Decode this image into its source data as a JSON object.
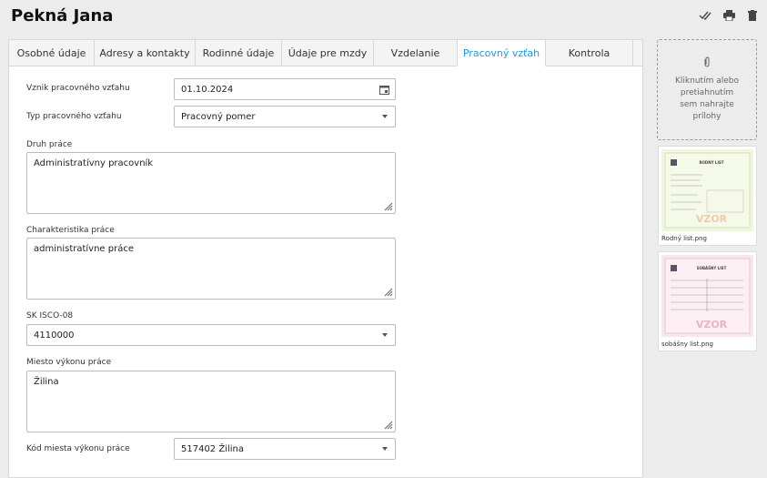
{
  "header": {
    "title": "Pekná Jana"
  },
  "tabs": [
    {
      "label": "Osobné údaje"
    },
    {
      "label": "Adresy a kontakty"
    },
    {
      "label": "Rodinné údaje"
    },
    {
      "label": "Údaje pre mzdy"
    },
    {
      "label": "Vzdelanie"
    },
    {
      "label": "Pracovný vzťah"
    },
    {
      "label": "Kontrola"
    }
  ],
  "form": {
    "start_label": "Vznik pracovného vzťahu",
    "start_value": "01.10.2024",
    "type_label": "Typ pracovného vzťahu",
    "type_value": "Pracovný pomer",
    "kind_label": "Druh práce",
    "kind_value": "Administratívny pracovník",
    "char_label": "Charakteristika práce",
    "char_value": "administratívne práce",
    "isco_label": "SK ISCO-08",
    "isco_value": "4110000",
    "place_label": "Miesto výkonu práce",
    "place_value": "Žilina",
    "place_code_label": "Kód miesta výkonu práce",
    "place_code_value": "517402 Žilina"
  },
  "attachments": {
    "dropzone_text": "Kliknutím alebo pretiahnutím sem nahrajte prílohy",
    "files": [
      {
        "name": "Rodný list.png",
        "doc_title": "RODNÝ LIST",
        "stamp": "VZOR"
      },
      {
        "name": "sobášny list.png",
        "doc_title": "SOBÁŠNY LIST",
        "stamp": "VZOR"
      }
    ]
  },
  "colors": {
    "accent": "#1e9ad6"
  }
}
